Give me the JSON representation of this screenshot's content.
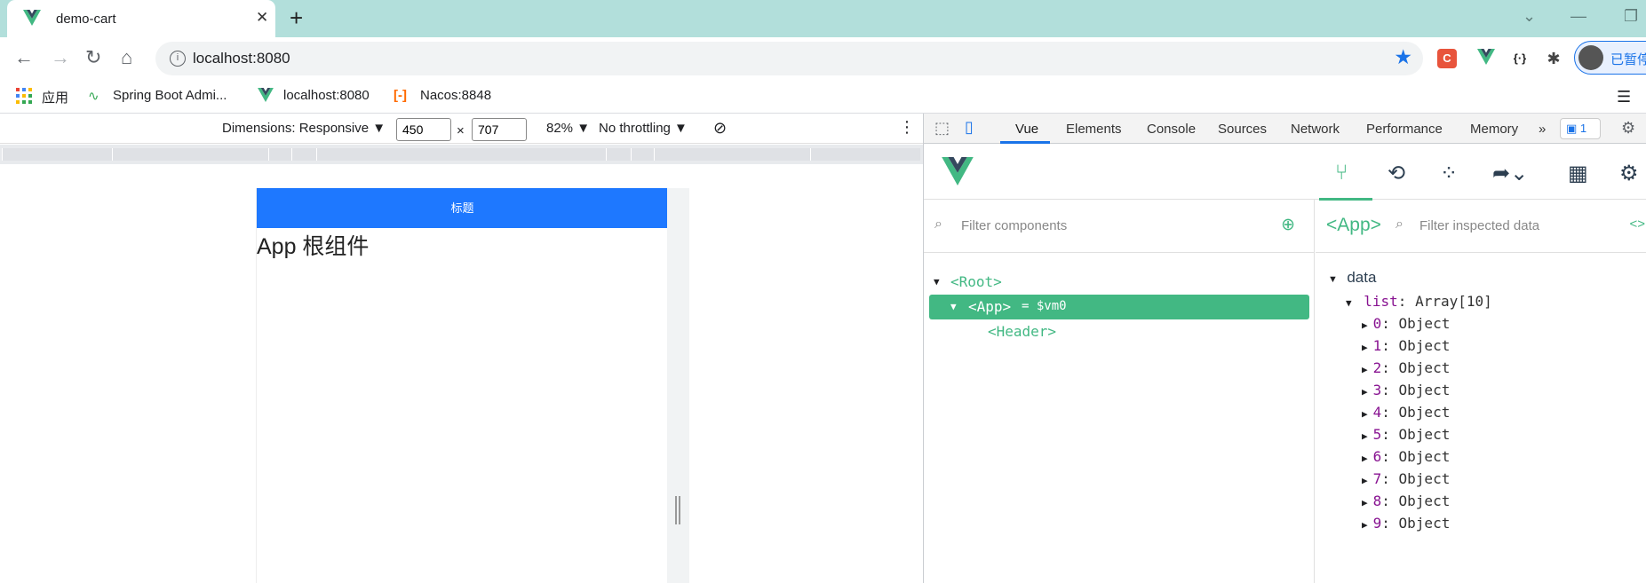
{
  "browser": {
    "tab_title": "demo-cart",
    "url": "localhost:8080",
    "profile_label": "已暂停",
    "bookmarks": [
      "应用",
      "Spring Boot Admi...",
      "localhost:8080",
      "Nacos:8848"
    ]
  },
  "device_toolbar": {
    "dimensions": "Dimensions: Responsive ▼",
    "width": "450",
    "height": "707",
    "times": "×",
    "zoom": "82% ▼",
    "throttling": "No throttling ▼"
  },
  "page": {
    "header_title": "标题",
    "root_text": "App 根组件"
  },
  "devtools": {
    "tabs": [
      "Vue",
      "Elements",
      "Console",
      "Sources",
      "Network",
      "Performance",
      "Memory"
    ],
    "issues_count": "1",
    "filter_components_placeholder": "Filter components",
    "inspected_name": "<App>",
    "filter_data_placeholder": "Filter inspected data",
    "tree": {
      "root": "<Root>",
      "app": "<App>",
      "app_suffix": "= $vm0",
      "header": "<Header>"
    },
    "data_section": "data",
    "list_key": "list",
    "list_value": "Array[10]",
    "items": [
      {
        "key": "0",
        "value": "Object"
      },
      {
        "key": "1",
        "value": "Object"
      },
      {
        "key": "2",
        "value": "Object"
      },
      {
        "key": "3",
        "value": "Object"
      },
      {
        "key": "4",
        "value": "Object"
      },
      {
        "key": "5",
        "value": "Object"
      },
      {
        "key": "6",
        "value": "Object"
      },
      {
        "key": "7",
        "value": "Object"
      },
      {
        "key": "8",
        "value": "Object"
      },
      {
        "key": "9",
        "value": "Object"
      }
    ]
  },
  "colors": {
    "vue_green": "#42b883",
    "header_blue": "#1e78ff",
    "tabstrip": "#b2dfdb"
  }
}
